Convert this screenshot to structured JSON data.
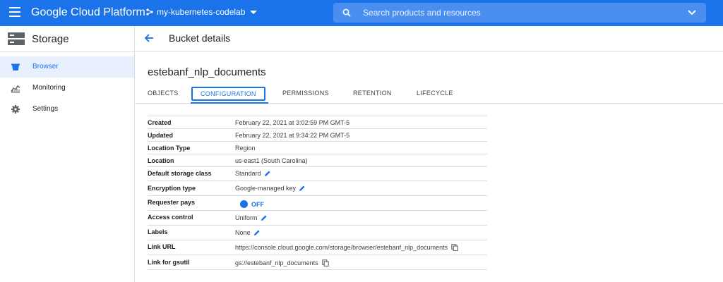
{
  "topbar": {
    "brand": "Google Cloud Platform",
    "project": "my-kubernetes-codelab",
    "search_placeholder": "Search products and resources",
    "accent": "#1a73e8"
  },
  "sidebar": {
    "title": "Storage",
    "items": [
      {
        "label": "Browser",
        "icon": "bucket-icon",
        "active": true
      },
      {
        "label": "Monitoring",
        "icon": "monitoring-chart-icon",
        "active": false
      },
      {
        "label": "Settings",
        "icon": "gear-icon",
        "active": false
      }
    ]
  },
  "header": {
    "title": "Bucket details"
  },
  "bucket": {
    "name": "estebanf_nlp_documents"
  },
  "tabs": [
    "OBJECTS",
    "CONFIGURATION",
    "PERMISSIONS",
    "RETENTION",
    "LIFECYCLE"
  ],
  "active_tab": "CONFIGURATION",
  "config": {
    "created": {
      "key": "Created",
      "value": "February 22, 2021 at 3:02:59 PM GMT-5"
    },
    "updated": {
      "key": "Updated",
      "value": "February 22, 2021 at 9:34:22 PM GMT-5"
    },
    "location_type": {
      "key": "Location Type",
      "value": "Region"
    },
    "location": {
      "key": "Location",
      "value": "us-east1 (South Carolina)"
    },
    "storage_class": {
      "key": "Default storage class",
      "value": "Standard"
    },
    "encryption": {
      "key": "Encryption type",
      "value": "Google-managed key"
    },
    "requester_pays": {
      "key": "Requester pays",
      "value": "OFF"
    },
    "access_control": {
      "key": "Access control",
      "value": "Uniform"
    },
    "labels": {
      "key": "Labels",
      "value": "None"
    },
    "link_url": {
      "key": "Link URL",
      "value": "https://console.cloud.google.com/storage/browser/estebanf_nlp_documents"
    },
    "gsutil": {
      "key": "Link for gsutil",
      "value": "gs://estebanf_nlp_documents"
    }
  }
}
